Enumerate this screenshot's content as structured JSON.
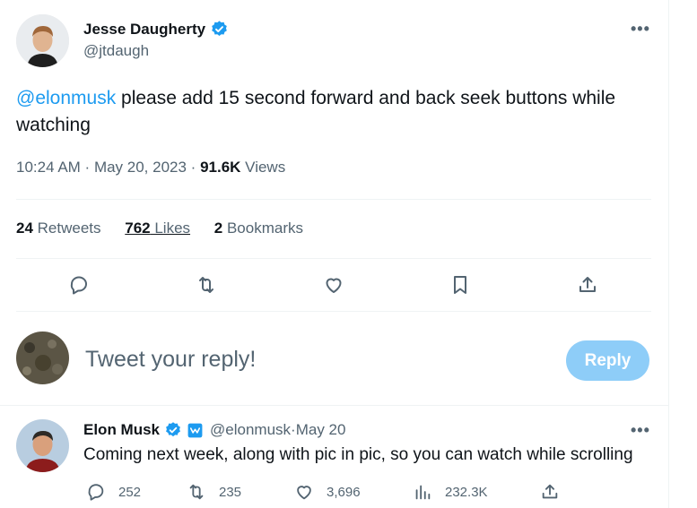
{
  "tweet": {
    "author_name": "Jesse Daugherty",
    "author_handle": "@jtdaugh",
    "more_label": "•••",
    "mention": "@elonmusk",
    "text_rest": " please add 15 second forward and back seek buttons while watching",
    "time": "10:24 AM",
    "sep1": " · ",
    "date": "May 20, 2023",
    "sep2": " · ",
    "views_count": "91.6K",
    "views_label": " Views",
    "retweets_count": "24",
    "retweets_label": " Retweets",
    "likes_count": "762",
    "likes_label": " Likes",
    "bookmarks_count": "2",
    "bookmarks_label": " Bookmarks"
  },
  "reply_box": {
    "placeholder": "Tweet your reply!",
    "button_label": "Reply"
  },
  "reply_tweet": {
    "author_name": "Elon Musk",
    "author_handle": "@elonmusk",
    "sep": " · ",
    "date": "May 20",
    "more_label": "•••",
    "text": "Coming next week, along with pic in pic, so you can watch while scrolling",
    "replies": "252",
    "retweets": "235",
    "likes": "3,696",
    "views": "232.3K"
  },
  "colors": {
    "accent": "#1d9bf0",
    "reply_button": "#8ecdf8",
    "secondary_text": "#536471"
  },
  "icons": [
    "verified-badge-icon",
    "reply-icon",
    "retweet-icon",
    "like-icon",
    "bookmark-icon",
    "share-icon",
    "views-icon",
    "business-badge-icon"
  ]
}
